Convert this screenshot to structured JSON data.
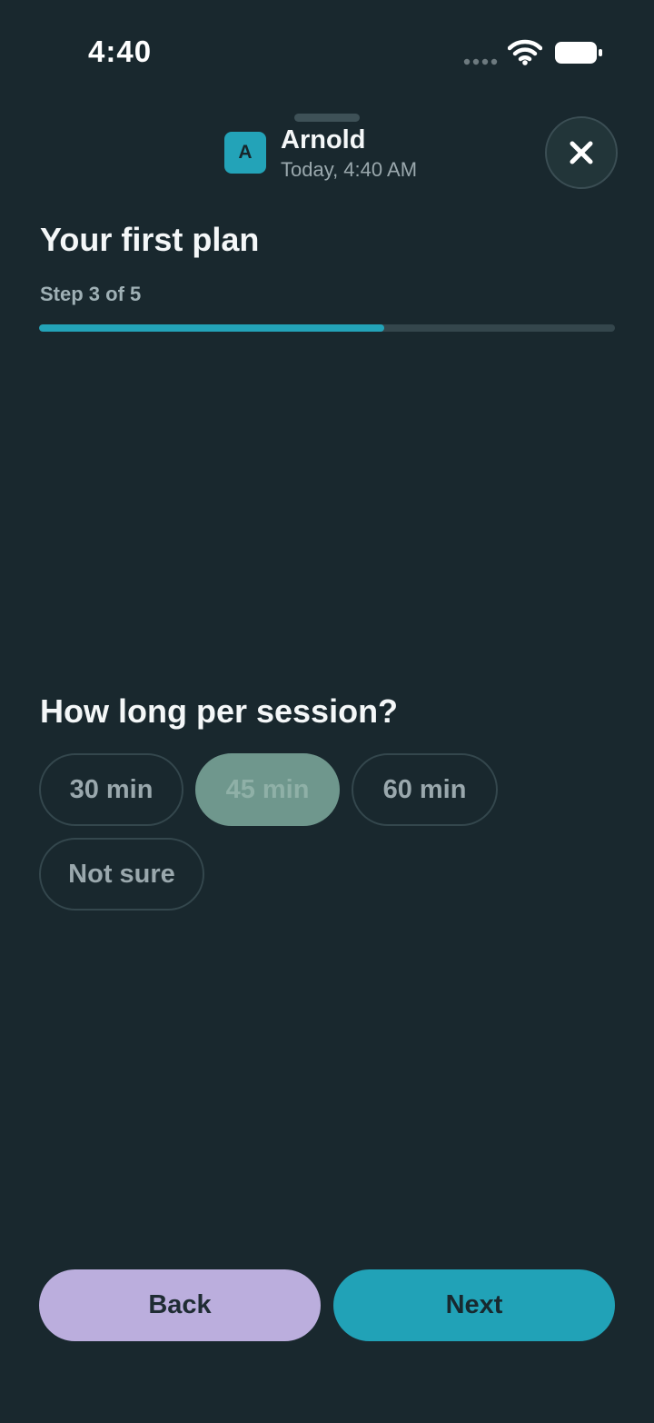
{
  "status_bar": {
    "time": "4:40"
  },
  "header": {
    "avatar_initial": "A",
    "sender_name": "Arnold",
    "timestamp": "Today, 4:40 AM"
  },
  "plan": {
    "title": "Your first plan",
    "step_label": "Step 3 of 5",
    "progress_percent": 60
  },
  "question": {
    "text": "How long per session?",
    "options": [
      {
        "label": "30 min",
        "selected": false
      },
      {
        "label": "45 min",
        "selected": true
      },
      {
        "label": "60 min",
        "selected": false
      },
      {
        "label": "Not sure",
        "selected": false
      }
    ]
  },
  "footer": {
    "back_label": "Back",
    "next_label": "Next"
  },
  "colors": {
    "background": "#19282E",
    "accent": "#23A3B8",
    "selected_chip": "#6F978D",
    "back_button": "#BBAEDD"
  }
}
